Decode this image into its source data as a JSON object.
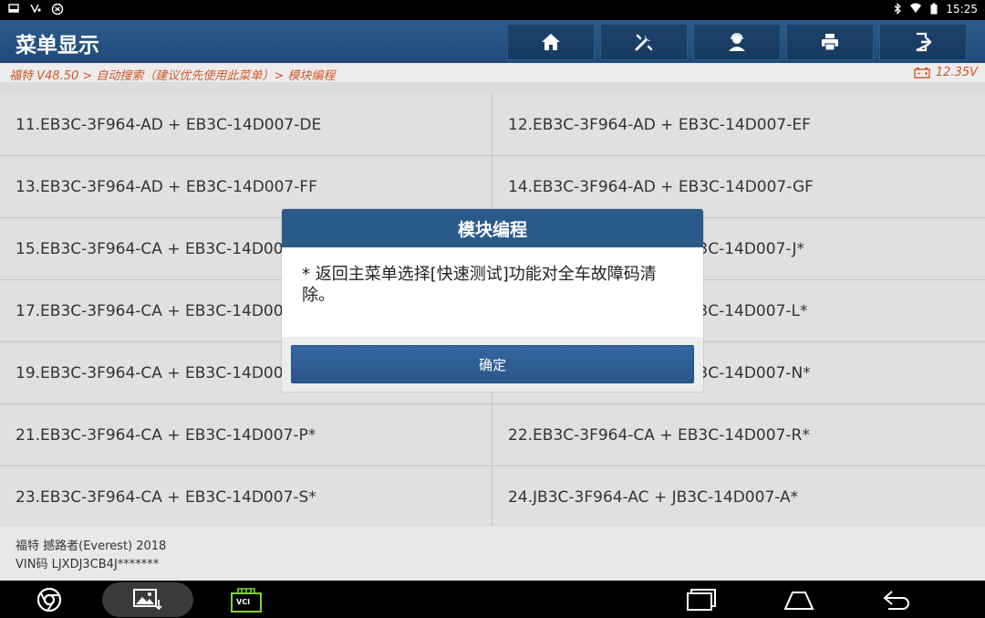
{
  "status_bar": {
    "time": "15:25",
    "icons_left": [
      "screenshot-icon",
      "usb-icon",
      "settings-icon"
    ],
    "icons_right": [
      "bluetooth-icon",
      "wifi-icon",
      "battery-icon"
    ]
  },
  "header": {
    "title": "菜单显示",
    "toolbar": [
      "home-icon",
      "diagnose-icon",
      "user-support-icon",
      "print-icon",
      "exit-icon"
    ]
  },
  "breadcrumb": {
    "path": "福特 V48.50 > 自动搜索（建议优先使用此菜单）> 模块编程",
    "voltage": "12.35V"
  },
  "list": {
    "items": [
      "11.EB3C-3F964-AD + EB3C-14D007-DE",
      "12.EB3C-3F964-AD + EB3C-14D007-EF",
      "13.EB3C-3F964-AD + EB3C-14D007-FF",
      "14.EB3C-3F964-AD + EB3C-14D007-GF",
      "15.EB3C-3F964-CA + EB3C-14D007-H*",
      "16.EB3C-3F964-CA + EB3C-14D007-J*",
      "17.EB3C-3F964-CA + EB3C-14D007-K*",
      "18.EB3C-3F964-CA + EB3C-14D007-L*",
      "19.EB3C-3F964-CA + EB3C-14D007-M*",
      "20.EB3C-3F964-CA + EB3C-14D007-N*",
      "21.EB3C-3F964-CA + EB3C-14D007-P*",
      "22.EB3C-3F964-CA + EB3C-14D007-R*",
      "23.EB3C-3F964-CA + EB3C-14D007-S*",
      "24.JB3C-3F964-AC + JB3C-14D007-A*"
    ]
  },
  "footer": {
    "vehicle": "福特 撼路者(Everest) 2018",
    "vin": "VIN码 LJXDJ3CB4J*******"
  },
  "dialog": {
    "title": "模块编程",
    "message": "* 返回主菜单选择[快速测试]功能对全车故障码清除。",
    "ok_label": "确定"
  },
  "navbar": {
    "items": [
      "chrome-icon",
      "gallery-icon",
      "vci-icon",
      "recents-icon",
      "home-nav-icon",
      "back-icon"
    ],
    "vci_label": "VCI"
  }
}
